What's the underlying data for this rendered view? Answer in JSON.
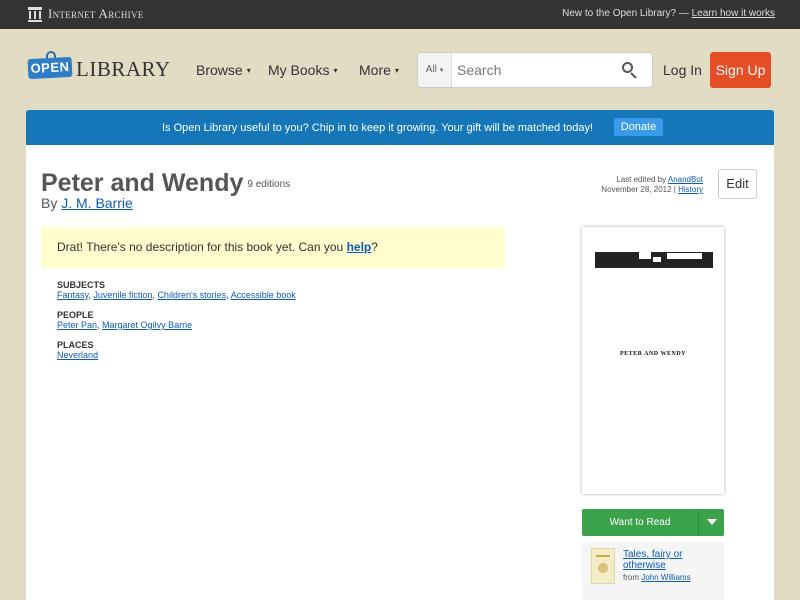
{
  "ia_bar": {
    "logo_text": "Internet Archive",
    "new_text": "New to the Open Library? —",
    "learn_link": "Learn how it works"
  },
  "header": {
    "logo_sign": "OPEN",
    "logo_word": "LIBRARY",
    "nav": {
      "browse": "Browse",
      "mybooks": "My Books",
      "more": "More"
    },
    "search": {
      "scope": "All",
      "placeholder": "Search"
    },
    "login": "Log In",
    "signup": "Sign Up"
  },
  "banner": {
    "message": "Is Open Library useful to you? Chip in to keep it growing. Your gift will be matched today!",
    "donate": "Donate"
  },
  "book": {
    "title": "Peter and Wendy",
    "editions": "9 editions",
    "by": "By",
    "author": "J. M. Barrie",
    "last_edited_prefix": "Last edited by",
    "last_edited_user": "AnandBot",
    "last_edited_date": "November 28, 2012 |",
    "history": "History",
    "edit_button": "Edit",
    "no_description_text": "Drat! There's no description for this book yet. Can you",
    "help_link": "help",
    "no_description_end": "?",
    "cover_title": "PETER AND WENDY"
  },
  "facets": {
    "subjects_label": "SUBJECTS",
    "subjects": [
      "Fantasy",
      "Juvenile fiction",
      "Children's stories",
      "Accessible book"
    ],
    "people_label": "PEOPLE",
    "people": [
      "Peter Pan",
      "Margaret Ogilvy Barrie"
    ],
    "places_label": "PLACES",
    "places": [
      "Neverland"
    ]
  },
  "sidebar": {
    "want_to_read": "Want to Read",
    "related_title": "Tales, fairy or otherwise",
    "related_from": "from",
    "related_author": "John Williams"
  },
  "colors": {
    "accent_blue": "#1577b8",
    "signup_red": "#e44d26",
    "want_green": "#3aa24a",
    "page_bg": "#e2dcc5"
  }
}
